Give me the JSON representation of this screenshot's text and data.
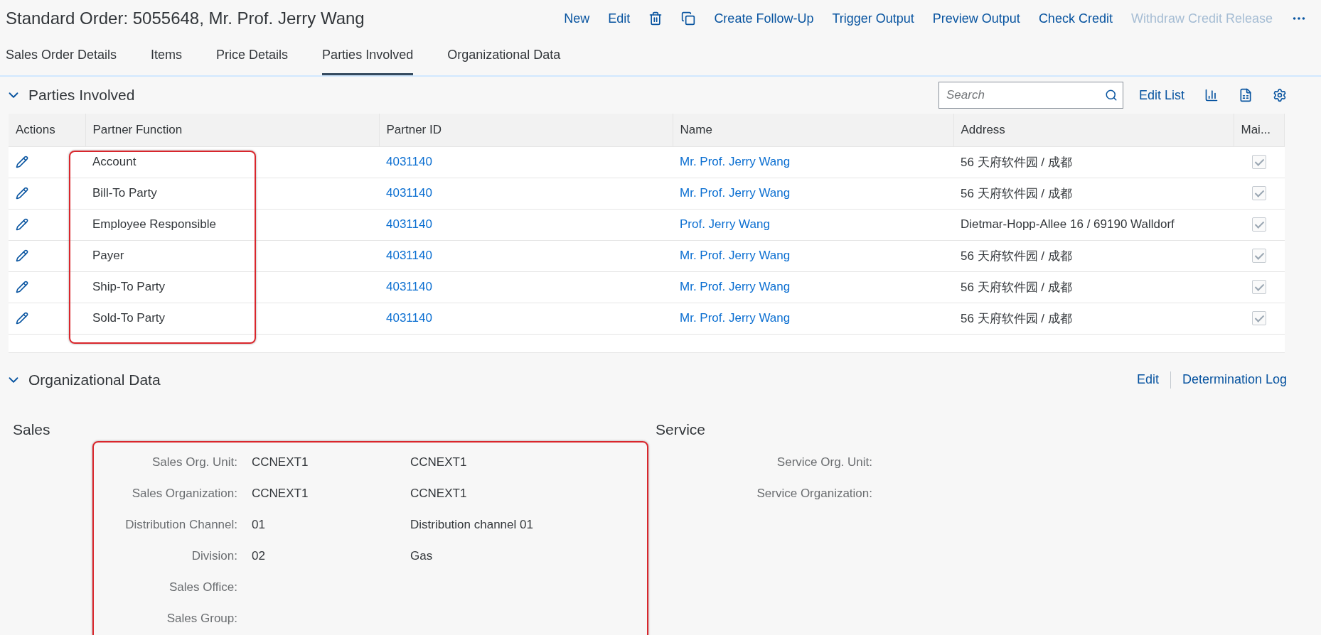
{
  "header": {
    "title": "Standard Order: 5055648, Mr. Prof. Jerry Wang",
    "actions": [
      {
        "kind": "text",
        "label": "New",
        "disabled": false
      },
      {
        "kind": "text",
        "label": "Edit",
        "disabled": false
      },
      {
        "kind": "delete",
        "disabled": false
      },
      {
        "kind": "copy",
        "disabled": false
      },
      {
        "kind": "text",
        "label": "Create Follow-Up",
        "disabled": false
      },
      {
        "kind": "text",
        "label": "Trigger Output",
        "disabled": false
      },
      {
        "kind": "text",
        "label": "Preview Output",
        "disabled": false
      },
      {
        "kind": "text",
        "label": "Check Credit",
        "disabled": false
      },
      {
        "kind": "text",
        "label": "Withdraw Credit Release",
        "disabled": true
      },
      {
        "kind": "more",
        "disabled": false
      }
    ]
  },
  "tabs": [
    {
      "label": "Sales Order Details",
      "selected": false
    },
    {
      "label": "Items",
      "selected": false
    },
    {
      "label": "Price Details",
      "selected": false
    },
    {
      "label": "Parties Involved",
      "selected": true
    },
    {
      "label": "Organizational Data",
      "selected": false
    }
  ],
  "parties": {
    "title": "Parties Involved",
    "expanded": true,
    "search": {
      "placeholder": "Search"
    },
    "toolbar": [
      {
        "kind": "text",
        "label": "Edit List"
      },
      {
        "kind": "chart"
      },
      {
        "kind": "export"
      },
      {
        "kind": "settings"
      }
    ],
    "columns": [
      "Actions",
      "Partner Function",
      "Partner ID",
      "Name",
      "Address",
      "Mai..."
    ],
    "rows": [
      {
        "function": "Account",
        "partner_id": "4031140",
        "name": "Mr. Prof. Jerry Wang",
        "address": "56 天府软件园 / 成都",
        "main": true
      },
      {
        "function": "Bill-To Party",
        "partner_id": "4031140",
        "name": "Mr. Prof. Jerry Wang",
        "address": "56 天府软件园 / 成都",
        "main": true
      },
      {
        "function": "Employee Responsible",
        "partner_id": "4031140",
        "name": "Prof. Jerry Wang",
        "address": "Dietmar-Hopp-Allee 16 / 69190 Walldorf",
        "main": true
      },
      {
        "function": "Payer",
        "partner_id": "4031140",
        "name": "Mr. Prof. Jerry Wang",
        "address": "56 天府软件园 / 成都",
        "main": true
      },
      {
        "function": "Ship-To Party",
        "partner_id": "4031140",
        "name": "Mr. Prof. Jerry Wang",
        "address": "56 天府软件园 / 成都",
        "main": true
      },
      {
        "function": "Sold-To Party",
        "partner_id": "4031140",
        "name": "Mr. Prof. Jerry Wang",
        "address": "56 天府软件园 / 成都",
        "main": true
      }
    ]
  },
  "org": {
    "title": "Organizational Data",
    "expanded": true,
    "actions": [
      "Edit",
      "Determination Log"
    ],
    "sales": {
      "title": "Sales",
      "fields": [
        {
          "label": "Sales Org. Unit:",
          "value": "CCNEXT1",
          "description": "CCNEXT1"
        },
        {
          "label": "Sales Organization:",
          "value": "CCNEXT1",
          "description": "CCNEXT1"
        },
        {
          "label": "Distribution Channel:",
          "value": "01",
          "description": "Distribution channel 01"
        },
        {
          "label": "Division:",
          "value": "02",
          "description": "Gas"
        },
        {
          "label": "Sales Office:"
        },
        {
          "label": "Sales Group:"
        }
      ]
    },
    "service": {
      "title": "Service",
      "fields": [
        {
          "label": "Service Org. Unit:"
        },
        {
          "label": "Service Organization:"
        }
      ]
    }
  }
}
